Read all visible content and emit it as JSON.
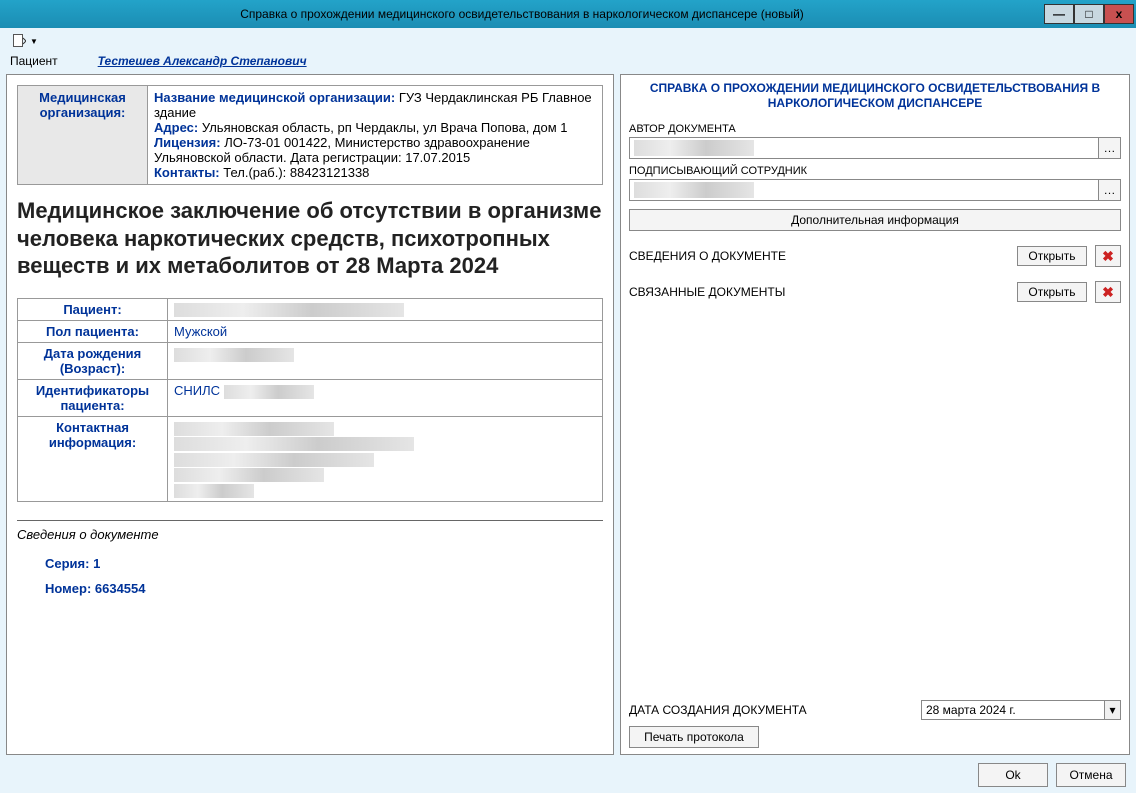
{
  "window": {
    "title": "Справка о прохождении медицинского освидетельствования в наркологическом диспансере (новый)"
  },
  "patient_bar": {
    "label": "Пациент",
    "name": "Тестешев Александр Степанович"
  },
  "org": {
    "row_label": "Медицинская организация:",
    "name_label": "Название медицинской организации:",
    "name_value": "ГУЗ Чердаклинская РБ Главное здание",
    "addr_label": "Адрес:",
    "addr_value": "Ульяновская область, рп Чердаклы, ул Врача Попова, дом 1",
    "lic_label": "Лицензия:",
    "lic_value": "ЛО-73-01 001422, Министерство здравоохранение Ульяновской области. Дата регистрации: 17.07.2015",
    "contacts_label": "Контакты:",
    "contacts_value": "Тел.(раб.): 88423121338"
  },
  "doc_title": "Медицинское заключение об отсутствии в организме человека наркотических средств, психотропных веществ и их метаболитов от 28 Марта 2024",
  "patient_table": {
    "patient_label": "Пациент:",
    "sex_label": "Пол пациента:",
    "sex_value": "Мужской",
    "dob_label": "Дата рождения (Возраст):",
    "ids_label": "Идентификаторы пациента:",
    "ids_prefix": "СНИЛС",
    "contact_label": "Контактная информация:"
  },
  "doc_info": {
    "section": "Сведения о документе",
    "series_label": "Серия: 1",
    "number_label": "Номер: 6634554"
  },
  "right": {
    "title": "СПРАВКА О ПРОХОЖДЕНИИ МЕДИЦИНСКОГО ОСВИДЕТЕЛЬСТВОВАНИЯ В НАРКОЛОГИЧЕСКОМ ДИСПАНСЕРЕ",
    "author_label": "АВТОР ДОКУМЕНТА",
    "signer_label": "ПОДПИСЫВАЮЩИЙ СОТРУДНИК",
    "extra_btn": "Дополнительная информация",
    "doc_info_label": "СВЕДЕНИЯ О ДОКУМЕНТЕ",
    "related_label": "СВЯЗАННЫЕ ДОКУМЕНТЫ",
    "open_btn": "Открыть",
    "date_label": "ДАТА СОЗДАНИЯ ДОКУМЕНТА",
    "date_value": "28   марта   2024 г.",
    "print_btn": "Печать протокола"
  },
  "footer": {
    "ok": "Ok",
    "cancel": "Отмена"
  }
}
